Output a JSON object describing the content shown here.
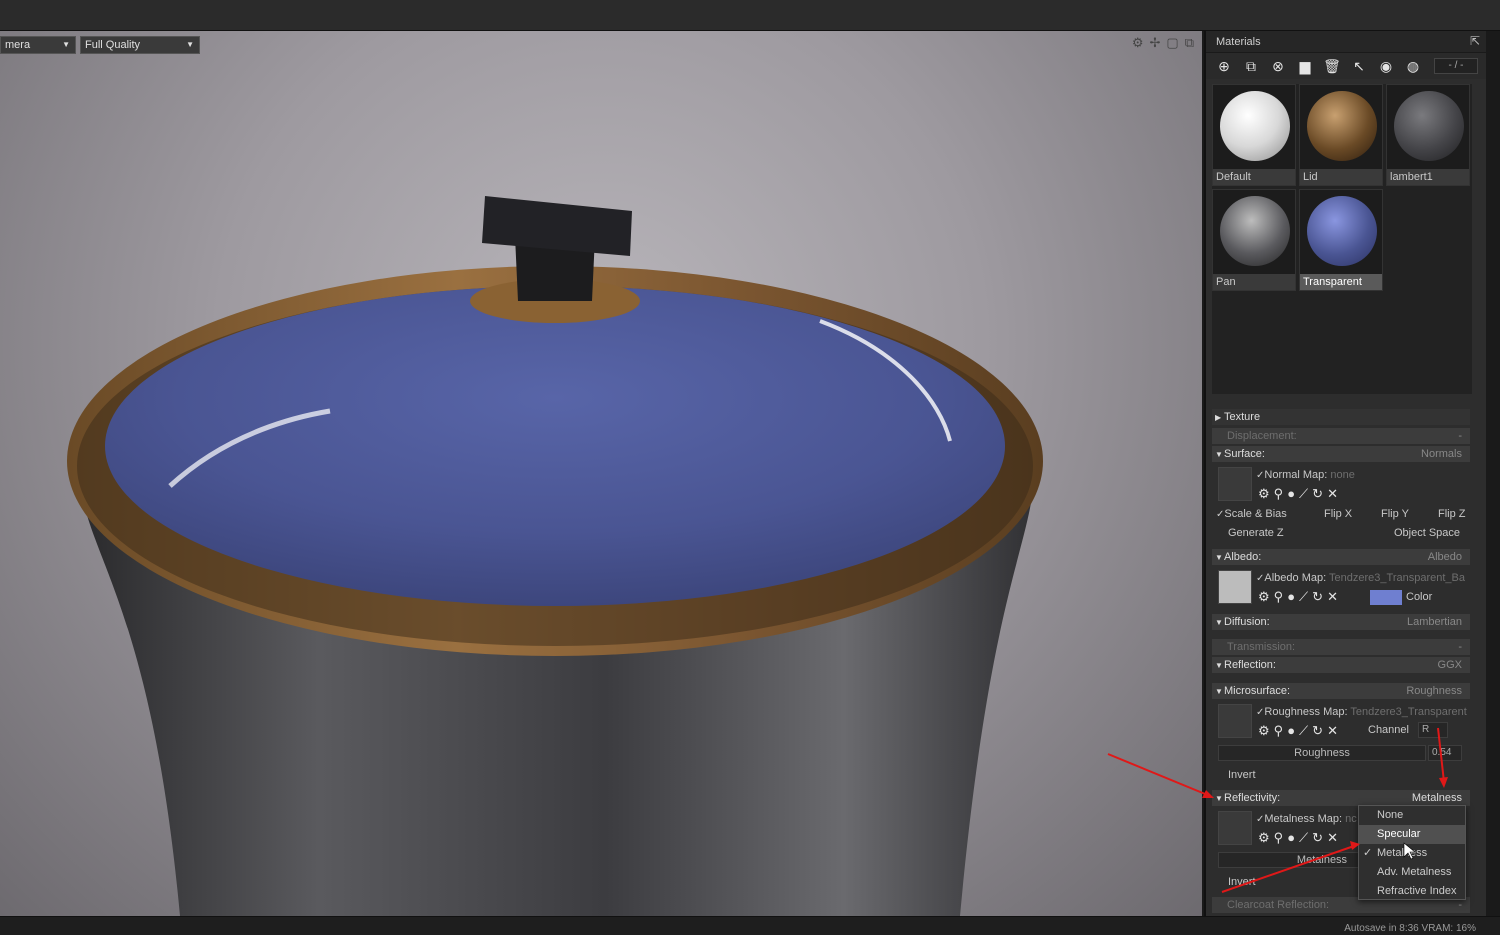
{
  "viewport": {
    "camera_select": "mera",
    "quality_select": "Full Quality"
  },
  "materials_panel": {
    "title": "Materials",
    "page_indicator": "- / -",
    "materials": [
      {
        "name": "Default",
        "selected": false
      },
      {
        "name": "Lid",
        "selected": false
      },
      {
        "name": "lambert1",
        "selected": false
      },
      {
        "name": "Pan",
        "selected": false
      },
      {
        "name": "Transparent",
        "selected": true
      }
    ]
  },
  "properties": {
    "texture": "Texture",
    "displacement": {
      "label": "Displacement:",
      "value": "-"
    },
    "surface": {
      "label": "Surface:",
      "value": "Normals",
      "normal_map_label": "Normal Map:",
      "normal_map_value": "none",
      "scale_bias": "Scale & Bias",
      "flip_x": "Flip X",
      "flip_y": "Flip Y",
      "flip_z": "Flip Z",
      "generate_z": "Generate Z",
      "object_space": "Object Space"
    },
    "albedo": {
      "label": "Albedo:",
      "value": "Albedo",
      "map_label": "Albedo Map:",
      "map_value": "Tendzere3_Transparent_Ba",
      "color_label": "Color",
      "color": "#6f7fd0"
    },
    "diffusion": {
      "label": "Diffusion:",
      "value": "Lambertian"
    },
    "transmission": {
      "label": "Transmission:",
      "value": "-"
    },
    "reflection": {
      "label": "Reflection:",
      "value": "GGX"
    },
    "microsurface": {
      "label": "Microsurface:",
      "value": "Roughness",
      "map_label": "Roughness Map:",
      "map_value": "Tendzere3_Transparent",
      "channel_label": "Channel",
      "channel_value": "R",
      "slider_label": "Roughness",
      "slider_value": "0.54",
      "invert": "Invert"
    },
    "reflectivity": {
      "label": "Reflectivity:",
      "value": "Metalness",
      "map_label": "Metalness Map:",
      "map_value": "nc",
      "slider_label": "Metalness",
      "invert": "Invert"
    },
    "clearcoat": {
      "label": "Clearcoat Reflection:",
      "value": "-"
    }
  },
  "reflectivity_dropdown": {
    "options": [
      "None",
      "Specular",
      "Metalness",
      "Adv. Metalness",
      "Refractive Index"
    ],
    "highlighted": "Specular",
    "checked": "Metalness"
  },
  "status": {
    "autosave": "Autosave in 8:36   VRAM: 16%"
  },
  "colors": {
    "annotation_arrow": "#e01818",
    "status_dot": "#5ec04a",
    "lid_blue": "#4a5593",
    "rim_bronze": "#8a6233"
  },
  "icons": [
    "add-material-icon",
    "duplicate-icon",
    "unused-icon",
    "folder-icon",
    "delete-icon",
    "select-icon",
    "apply-icon",
    "paint-icon",
    "gear-icon",
    "search-icon",
    "dropper-icon",
    "brush-icon",
    "reload-icon",
    "close-icon"
  ]
}
